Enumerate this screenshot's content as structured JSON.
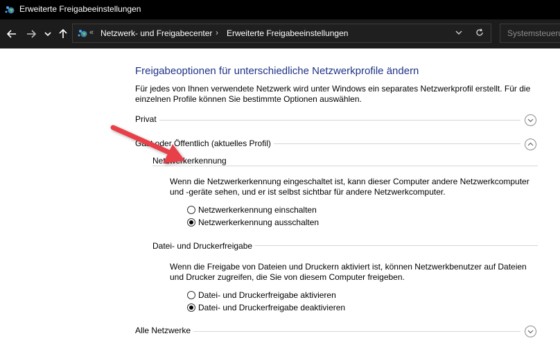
{
  "window": {
    "title": "Erweiterte Freigabeeinstellungen"
  },
  "address_bar": {
    "overflow": "«",
    "breadcrumbs": [
      "Netzwerk- und Freigabecenter",
      "Erweiterte Freigabeeinstellungen"
    ]
  },
  "search": {
    "placeholder": "Systemsteueru"
  },
  "page": {
    "title": "Freigabeoptionen für unterschiedliche Netzwerkprofile ändern",
    "intro": "Für jedes von Ihnen verwendete Netzwerk wird unter Windows ein separates Netzwerkprofil erstellt. Für die einzelnen Profile können Sie bestimmte Optionen auswählen."
  },
  "profiles": {
    "private": {
      "label": "Privat",
      "expanded": false
    },
    "guest": {
      "label": "Gast oder Öffentlich (aktuelles Profil)",
      "expanded": true,
      "network_discovery": {
        "heading": "Netzwerkerkennung",
        "description": "Wenn die Netzwerkerkennung eingeschaltet ist, kann dieser Computer andere Netzwerkcomputer und -geräte sehen, und er ist selbst sichtbar für andere Netzwerkcomputer.",
        "option_on": "Netzwerkerkennung einschalten",
        "option_off": "Netzwerkerkennung ausschalten",
        "selected": "off"
      },
      "file_printer_sharing": {
        "heading": "Datei- und Druckerfreigabe",
        "description": "Wenn die Freigabe von Dateien und Druckern aktiviert ist, können Netzwerkbenutzer auf Dateien und Drucker zugreifen, die Sie von diesem Computer freigeben.",
        "option_on": "Datei- und Druckerfreigabe aktivieren",
        "option_off": "Datei- und Druckerfreigabe deaktivieren",
        "selected": "off"
      }
    },
    "all": {
      "label": "Alle Netzwerke",
      "expanded": false
    }
  },
  "colors": {
    "title_blue": "#1e3287",
    "annotation_arrow": "#e8404a",
    "chrome_dark": "#1c1c1c"
  }
}
